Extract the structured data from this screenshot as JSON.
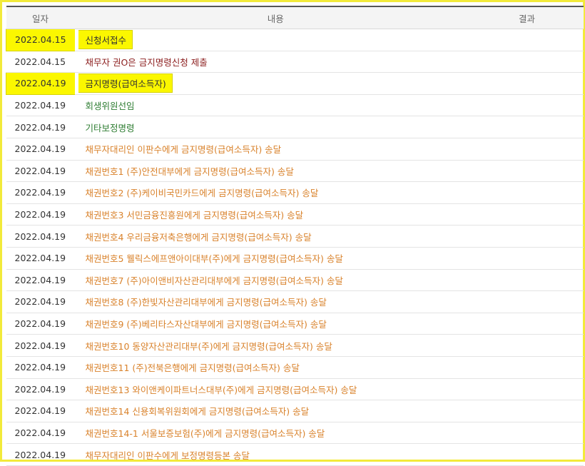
{
  "header": {
    "date": "일자",
    "content": "내용",
    "result": "결과"
  },
  "colors": {
    "green": "#2e7d32",
    "darkred": "#8b1d1d",
    "orange": "#d9822b",
    "highlight": "#fbf700"
  },
  "rows": [
    {
      "date": "2022.04.15",
      "content": "신청서접수",
      "color": "black",
      "highlight": true
    },
    {
      "date": "2022.04.15",
      "content": "채무자 권O은 금지명령신청 제출",
      "color": "darkred",
      "highlight": false
    },
    {
      "date": "2022.04.19",
      "content": "금지명령(급여소득자)",
      "color": "black",
      "highlight": true
    },
    {
      "date": "2022.04.19",
      "content": "회생위원선임",
      "color": "green",
      "highlight": false
    },
    {
      "date": "2022.04.19",
      "content": "기타보정명령",
      "color": "green",
      "highlight": false
    },
    {
      "date": "2022.04.19",
      "content": "채무자대리인 이판수에게 금지명령(급여소득자) 송달",
      "color": "orange",
      "highlight": false
    },
    {
      "date": "2022.04.19",
      "content": "채권번호1 (주)안전대부에게 금지명령(급여소득자) 송달",
      "color": "orange",
      "highlight": false
    },
    {
      "date": "2022.04.19",
      "content": "채권번호2 (주)케이비국민카드에게 금지명령(급여소득자) 송달",
      "color": "orange",
      "highlight": false
    },
    {
      "date": "2022.04.19",
      "content": "채권번호3 서민금융진흥원에게 금지명령(급여소득자) 송달",
      "color": "orange",
      "highlight": false
    },
    {
      "date": "2022.04.19",
      "content": "채권번호4 우리금융저축은행에게 금지명령(급여소득자) 송달",
      "color": "orange",
      "highlight": false
    },
    {
      "date": "2022.04.19",
      "content": "채권번호5 웰릭스에프앤아이대부(주)에게 금지명령(급여소득자) 송달",
      "color": "orange",
      "highlight": false
    },
    {
      "date": "2022.04.19",
      "content": "채권번호7 (주)아이앤비자산관리대부에게 금지명령(급여소득자) 송달",
      "color": "orange",
      "highlight": false
    },
    {
      "date": "2022.04.19",
      "content": "채권번호8 (주)한빛자산관리대부에게 금지명령(급여소득자) 송달",
      "color": "orange",
      "highlight": false
    },
    {
      "date": "2022.04.19",
      "content": "채권번호9 (주)베리타스자산대부에게 금지명령(급여소득자) 송달",
      "color": "orange",
      "highlight": false
    },
    {
      "date": "2022.04.19",
      "content": "채권번호10 동양자산관리대부(주)에게 금지명령(급여소득자) 송달",
      "color": "orange",
      "highlight": false
    },
    {
      "date": "2022.04.19",
      "content": "채권번호11 (주)전북은행에게 금지명령(급여소득자) 송달",
      "color": "orange",
      "highlight": false
    },
    {
      "date": "2022.04.19",
      "content": "채권번호13 와이앤케이파트너스대부(주)에게 금지명령(급여소득자) 송달",
      "color": "orange",
      "highlight": false
    },
    {
      "date": "2022.04.19",
      "content": "채권번호14 신용회복위원회에게 금지명령(급여소득자) 송달",
      "color": "orange",
      "highlight": false
    },
    {
      "date": "2022.04.19",
      "content": "채권번호14-1 서울보증보험(주)에게 금지명령(급여소득자) 송달",
      "color": "orange",
      "highlight": false
    },
    {
      "date": "2022.04.19",
      "content": "채무자대리인 이판수에게 보정명령등본 송달",
      "color": "orange",
      "highlight": false
    }
  ]
}
